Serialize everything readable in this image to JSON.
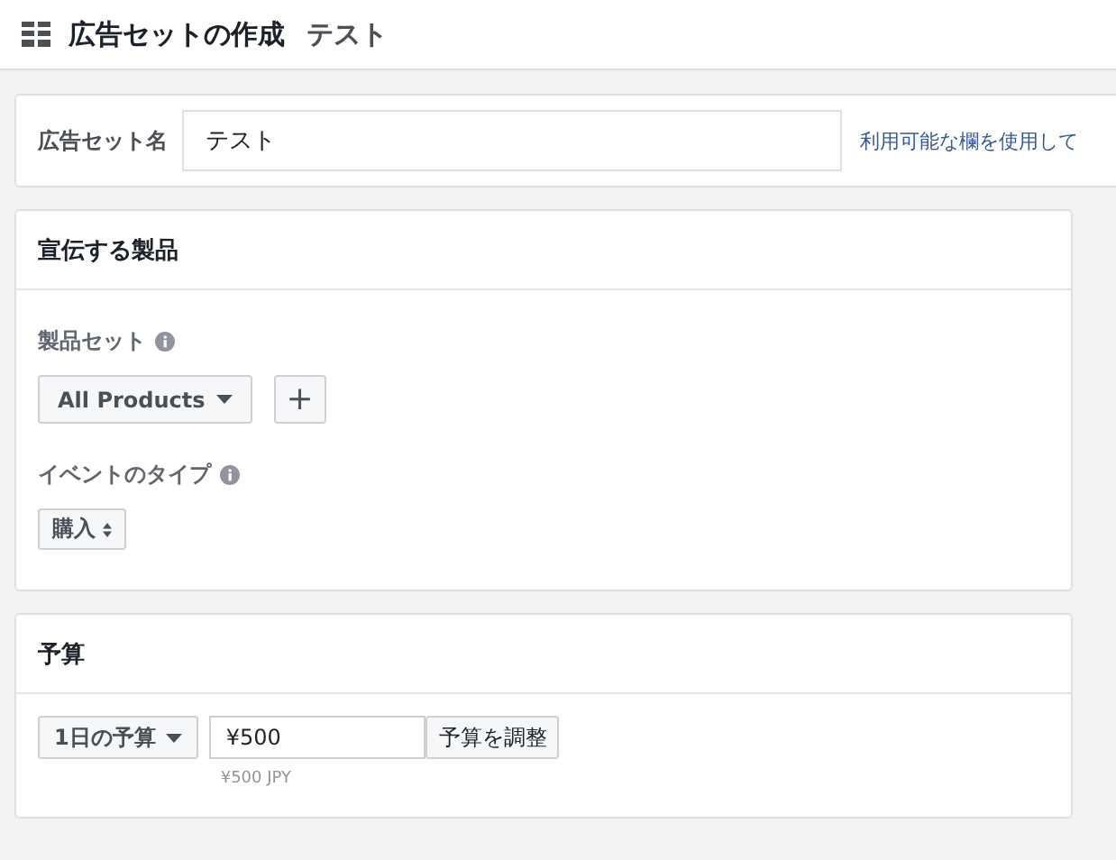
{
  "header": {
    "title": "広告セットの作成",
    "subtitle": "テスト"
  },
  "name_card": {
    "label": "広告セット名",
    "value": "テスト",
    "link": "利用可能な欄を使用して"
  },
  "product_card": {
    "title": "宣伝する製品",
    "fields": [
      {
        "label": "製品セット",
        "kind": "dropdown",
        "value": "All Products",
        "add_button": "+"
      },
      {
        "label": "イベントのタイプ",
        "kind": "select",
        "value": "購入"
      }
    ]
  },
  "budget_card": {
    "title": "予算",
    "type": "1日の予算",
    "amount": "¥500",
    "adjust_button": "予算を調整",
    "note": "¥500 JPY"
  }
}
